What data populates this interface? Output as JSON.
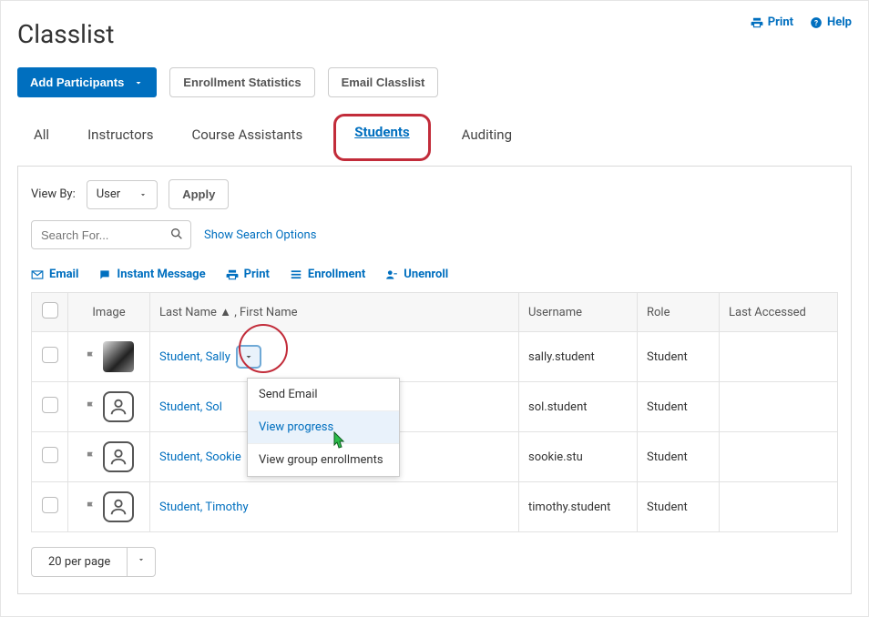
{
  "header": {
    "title": "Classlist",
    "print_label": "Print",
    "help_label": "Help"
  },
  "actions": {
    "add_participants": "Add Participants",
    "enrollment_stats": "Enrollment Statistics",
    "email_classlist": "Email Classlist"
  },
  "tabs": [
    "All",
    "Instructors",
    "Course Assistants",
    "Students",
    "Auditing"
  ],
  "tabs_active_index": 3,
  "filter": {
    "viewby_label": "View By:",
    "viewby_value": "User",
    "apply_label": "Apply"
  },
  "search": {
    "placeholder": "Search For...",
    "show_options": "Show Search Options"
  },
  "tools": {
    "email": "Email",
    "im": "Instant Message",
    "print": "Print",
    "enrollment": "Enrollment",
    "unenroll": "Unenroll"
  },
  "table": {
    "headers": {
      "image": "Image",
      "name": "Last Name ▲ , First Name",
      "username": "Username",
      "role": "Role",
      "last_accessed": "Last Accessed"
    },
    "rows": [
      {
        "name": "Student, Sally",
        "username": "sally.student",
        "role": "Student",
        "avatar": "photo"
      },
      {
        "name": "Student, Sol",
        "username": "sol.student",
        "role": "Student",
        "avatar": "placeholder"
      },
      {
        "name": "Student, Sookie",
        "username": "sookie.stu",
        "role": "Student",
        "avatar": "placeholder"
      },
      {
        "name": "Student, Timothy",
        "username": "timothy.student",
        "role": "Student",
        "avatar": "placeholder"
      }
    ]
  },
  "context_menu": {
    "items": [
      "Send Email",
      "View progress",
      "View group enrollments"
    ],
    "hover_index": 1
  },
  "pager": {
    "label": "20 per page"
  }
}
